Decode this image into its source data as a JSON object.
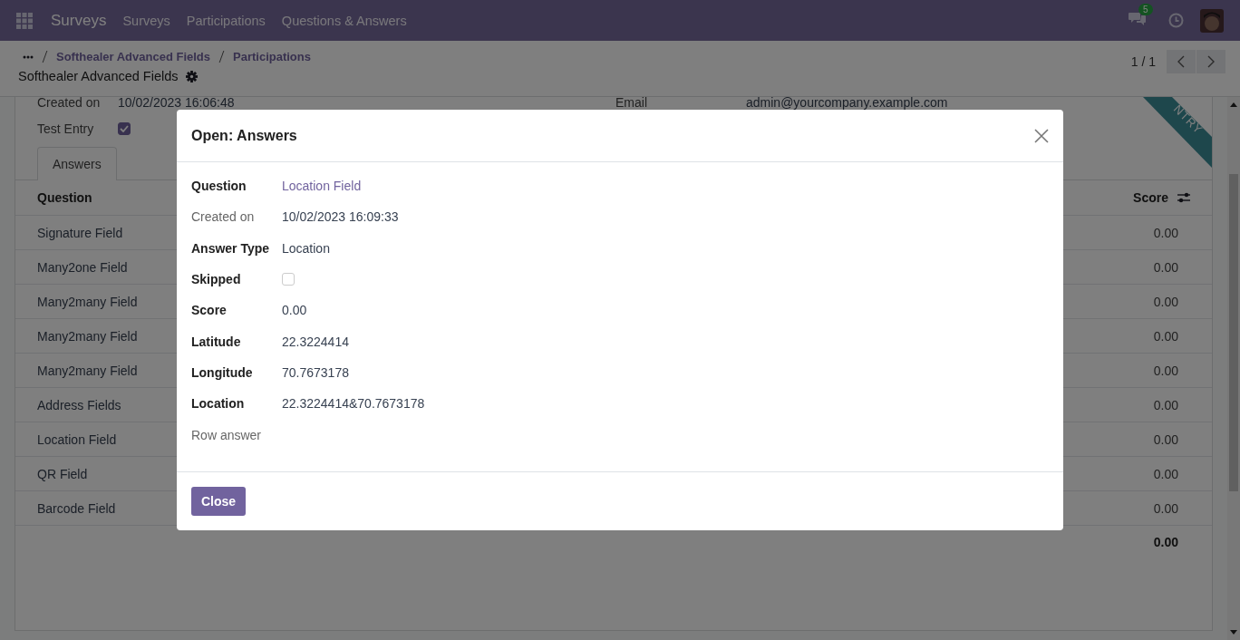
{
  "navbar": {
    "app_name": "Surveys",
    "menu": [
      "Surveys",
      "Participations",
      "Questions & Answers"
    ],
    "messages_count": "5"
  },
  "control_panel": {
    "breadcrumb": [
      "Softhealer Advanced Fields",
      "Participations"
    ],
    "title": "Softhealer Advanced Fields",
    "pager": "1 / 1"
  },
  "form": {
    "fields_left": [
      {
        "label": "Created on",
        "value": "10/02/2023 16:06:48"
      }
    ],
    "fields_right": [
      {
        "label": "Email",
        "value": "admin@yourcompany.example.com"
      }
    ],
    "test_entry": {
      "label": "Test Entry",
      "checked": true
    },
    "ribbon": "NTRY",
    "tabs": [
      {
        "label": "Answers",
        "selected": true
      }
    ],
    "table": {
      "columns": [
        "Question",
        "Score"
      ],
      "rows": [
        {
          "question": "Signature Field",
          "score": "0.00"
        },
        {
          "question": "Many2one Field",
          "score": "0.00"
        },
        {
          "question": "Many2many Field",
          "score": "0.00"
        },
        {
          "question": "Many2many Field",
          "score": "0.00"
        },
        {
          "question": "Many2many Field",
          "score": "0.00"
        },
        {
          "question": "Address Fields",
          "score": "0.00"
        },
        {
          "question": "Location Field",
          "score": "0.00"
        },
        {
          "question": "QR Field",
          "score": "0.00"
        },
        {
          "question": "Barcode Field",
          "score": "0.00"
        }
      ],
      "total": "0.00"
    }
  },
  "dialog": {
    "title": "Open: Answers",
    "fields": [
      {
        "kind": "link",
        "label": "Question",
        "muted": false,
        "value": "Location Field"
      },
      {
        "kind": "text",
        "label": "Created on",
        "muted": true,
        "value": "10/02/2023 16:09:33"
      },
      {
        "kind": "text",
        "label": "Answer Type",
        "muted": false,
        "value": "Location"
      },
      {
        "kind": "checkbox",
        "label": "Skipped",
        "muted": false,
        "checked": false
      },
      {
        "kind": "text",
        "label": "Score",
        "muted": false,
        "value": "0.00"
      },
      {
        "kind": "text",
        "label": "Latitude",
        "muted": false,
        "value": "22.3224414"
      },
      {
        "kind": "text",
        "label": "Longitude",
        "muted": false,
        "value": "70.7673178"
      },
      {
        "kind": "text",
        "label": "Location",
        "muted": false,
        "value": "22.3224414&70.7673178"
      },
      {
        "kind": "empty",
        "label": "Row answer",
        "muted": true
      }
    ],
    "button": "Close"
  }
}
